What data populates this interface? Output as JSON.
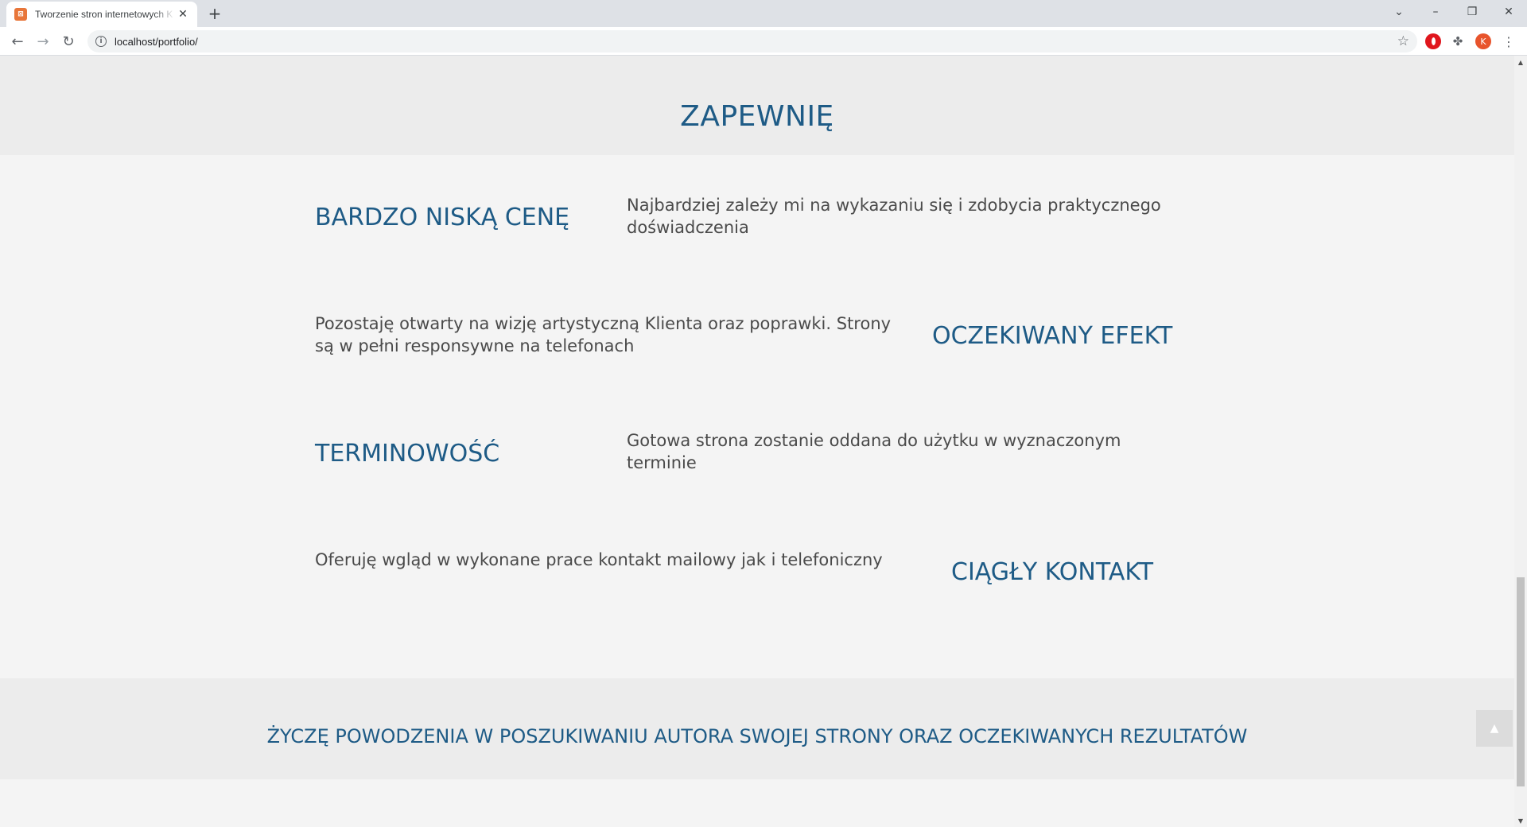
{
  "browser": {
    "tab_title": "Tworzenie stron internetowych K",
    "tab_favicon": "xampp-icon",
    "url": "localhost/portfolio/",
    "avatar_letter": "K"
  },
  "page": {
    "section_title": "ZAPEWNIĘ",
    "features": [
      {
        "heading": "BARDZO NISKĄ CENĘ",
        "text": "Najbardziej zależy mi na wykazaniu się i zdobycia praktycznego doświadczenia"
      },
      {
        "heading": "OCZEKIWANY EFEKT",
        "text": "Pozostaję otwarty na wizję artystyczną Klienta oraz poprawki. Strony są w pełni responsywne na telefonach"
      },
      {
        "heading": "TERMINOWOŚĆ",
        "text": "Gotowa strona zostanie oddana do użytku w wyznaczonym terminie"
      },
      {
        "heading": "CIĄGŁY KONTAKT",
        "text": "Oferuję wgląd w wykonane prace kontakt mailowy jak i telefoniczny"
      }
    ],
    "closing_text": "ŻYCZĘ POWODZENIA W POSZUKIWANIU AUTORA SWOJEJ STRONY ORAZ OCZEKIWANYCH REZULTATÓW"
  },
  "colors": {
    "heading": "#1e5b86",
    "body_text": "#4a4a4a",
    "band": "#ececec",
    "page_bg": "#f4f4f4"
  }
}
